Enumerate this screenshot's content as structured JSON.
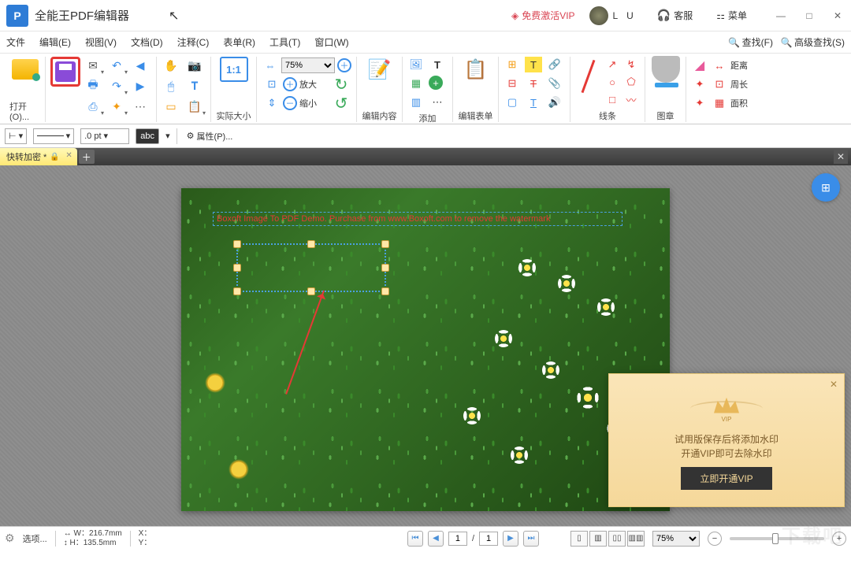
{
  "app": {
    "title": "全能王PDF编辑器"
  },
  "titlebar": {
    "vip": "免费激活VIP",
    "username": "L U",
    "support": "客服",
    "menu": "菜单"
  },
  "menus": [
    "文件",
    "编辑(E)",
    "视图(V)",
    "文档(D)",
    "注释(C)",
    "表单(R)",
    "工具(T)",
    "窗口(W)"
  ],
  "menu_right": {
    "find": "查找(F)",
    "advanced_find": "高级查找(S)"
  },
  "ribbon": {
    "open": "打开(O)...",
    "actual_size": "实际大小",
    "zoom_in": "放大",
    "zoom_out": "缩小",
    "zoom_value": "75%",
    "edit_content": "编辑内容",
    "add": "添加",
    "edit_form": "编辑表单",
    "lines": "线条",
    "stamp": "图章",
    "distance": "距离",
    "perimeter": "周长",
    "area": "面积"
  },
  "secondbar": {
    "pt_value": ".0 pt",
    "abc": "abc",
    "properties": "属性(P)..."
  },
  "tab": {
    "name": "快转加密 *"
  },
  "page": {
    "watermark_text": "Boxoft Image To PDF Demo. Purchase from www.Boxoft.com to remove the watermark"
  },
  "vip_toast": {
    "line1": "试用版保存后将添加水印",
    "line2": "开通VIP即可去除水印",
    "button": "立即开通VIP"
  },
  "status": {
    "options": "选项...",
    "w_label": "W：",
    "w_value": "216.7mm",
    "h_label": "H：",
    "h_value": "135.5mm",
    "x_label": "X：",
    "y_label": "Y：",
    "page_current": "1",
    "page_sep": "/",
    "page_total": "1",
    "zoom_value": "75%"
  }
}
